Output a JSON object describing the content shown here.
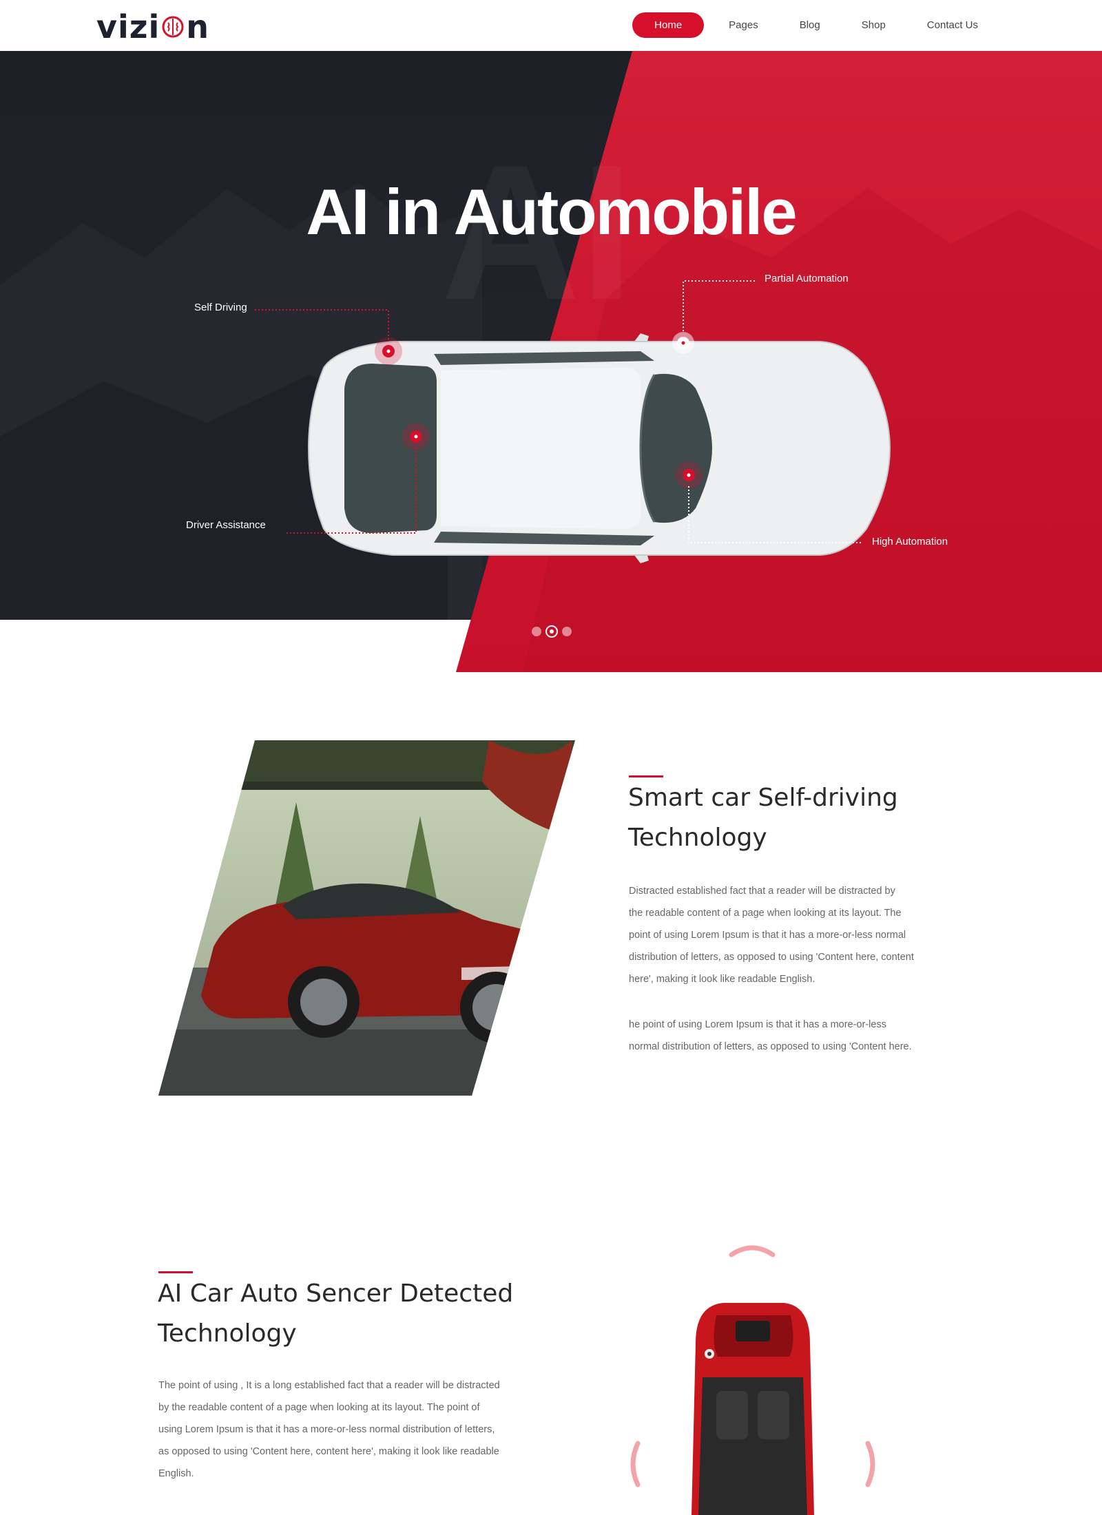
{
  "header": {
    "logo_text_left": "vizi",
    "logo_text_right": "n",
    "nav": [
      {
        "label": "Home",
        "active": true
      },
      {
        "label": "Pages",
        "active": false
      },
      {
        "label": "Blog",
        "active": false
      },
      {
        "label": "Shop",
        "active": false
      },
      {
        "label": "Contact Us",
        "active": false
      }
    ]
  },
  "hero": {
    "title": "AI in Automobile",
    "callouts": {
      "self_driving": "Self Driving",
      "partial_automation": "Partial Automation",
      "driver_assistance": "Driver Assistance",
      "high_automation": "High Automation"
    },
    "slider": {
      "total": 3,
      "active_index": 1
    }
  },
  "section1": {
    "title_line1": "Smart car Self-driving",
    "title_line2": "Technology",
    "para1_lines": [
      "Distracted established fact that a reader will be distracted by",
      "the readable content of a page when looking at its layout. The",
      "point of using Lorem Ipsum is that it has a more-or-less normal",
      "distribution of letters, as opposed to using 'Content here, content",
      "here', making it look like readable English."
    ],
    "para2_lines": [
      "he point of using Lorem Ipsum is that it has a more-or-less",
      "normal distribution of letters, as opposed to using 'Content here."
    ]
  },
  "section2": {
    "title_line1": "AI Car Auto Sencer Detected",
    "title_line2": "Technology",
    "para_lines": [
      "The point of using , It is a long established fact that a reader will be distracted",
      "by the readable content of a page when looking at its layout. The point of",
      "using Lorem Ipsum is that it has a more-or-less normal distribution of letters,",
      "as opposed to using 'Content here, content here', making it look like readable",
      "English."
    ]
  },
  "colors": {
    "accent": "#d6102b",
    "dark": "#1e2028",
    "text": "#666666"
  }
}
